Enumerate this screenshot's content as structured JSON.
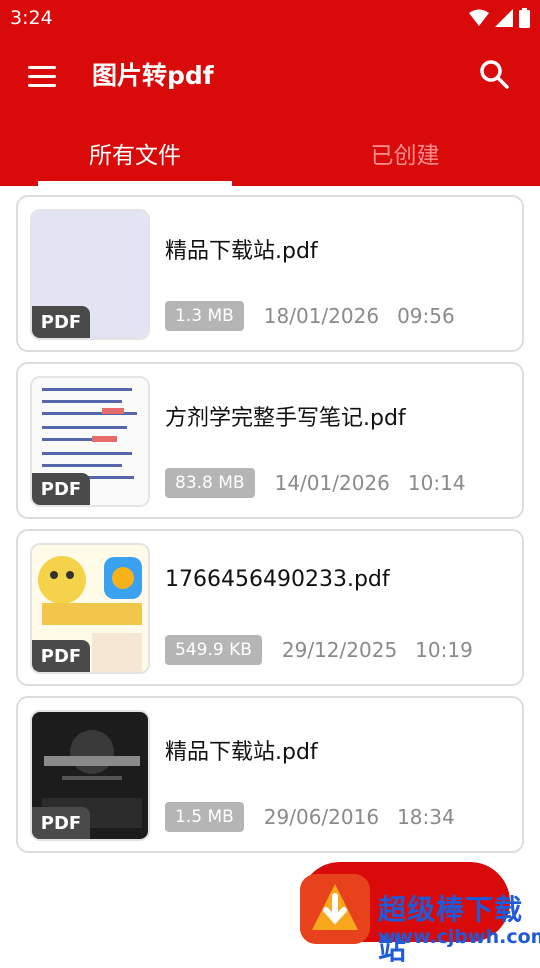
{
  "status_bar": {
    "time": "3:24"
  },
  "app_bar": {
    "title": "图片转pdf"
  },
  "tabs": [
    {
      "label": "所有文件",
      "active": true
    },
    {
      "label": "已创建",
      "active": false
    }
  ],
  "files": [
    {
      "name": "精品下载站.pdf",
      "size": "1.3 MB",
      "date": "18/01/2026",
      "time": "09:56",
      "badge": "PDF"
    },
    {
      "name": "方剂学完整手写笔记.pdf",
      "size": "83.8 MB",
      "date": "14/01/2026",
      "time": "10:14",
      "badge": "PDF"
    },
    {
      "name": "1766456490233.pdf",
      "size": "549.9 KB",
      "date": "29/12/2025",
      "time": "10:19",
      "badge": "PDF"
    },
    {
      "name": "精品下载站.pdf",
      "size": "1.5 MB",
      "date": "29/06/2016",
      "time": "18:34",
      "badge": "PDF"
    }
  ],
  "watermark": {
    "text": "超级棒下载站",
    "url": "www.cjbwh.com"
  },
  "colors": {
    "primary": "#d90a0a",
    "tab_inactive": "#ff8f8f",
    "size_badge": "#b5b5b5"
  }
}
